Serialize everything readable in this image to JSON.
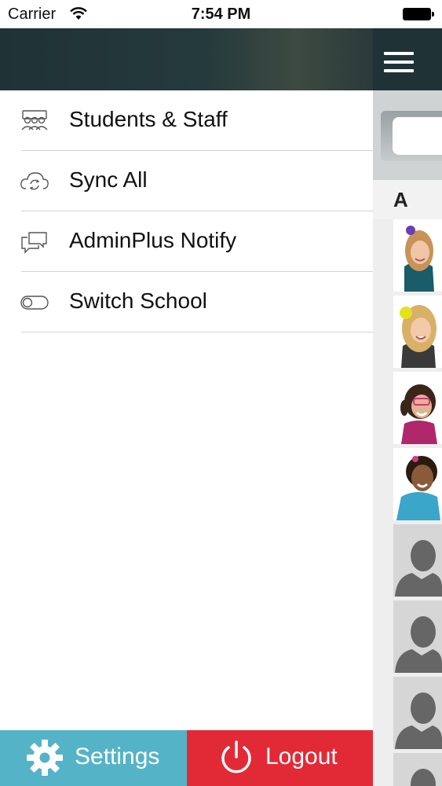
{
  "status_bar": {
    "carrier": "Carrier",
    "time": "7:54 PM"
  },
  "menu": {
    "items": [
      {
        "label": "Students & Staff",
        "icon": "people-group-icon"
      },
      {
        "label": "Sync All",
        "icon": "cloud-sync-icon"
      },
      {
        "label": "AdminPlus Notify",
        "icon": "chat-bubbles-icon"
      },
      {
        "label": "Switch School",
        "icon": "toggle-switch-icon"
      }
    ]
  },
  "footer": {
    "settings_label": "Settings",
    "logout_label": "Logout",
    "settings_color": "#55b3c7",
    "logout_color": "#e22a37"
  },
  "contact_list": {
    "section_letter": "A"
  },
  "colors": {
    "header_dark": "#1f3337"
  }
}
